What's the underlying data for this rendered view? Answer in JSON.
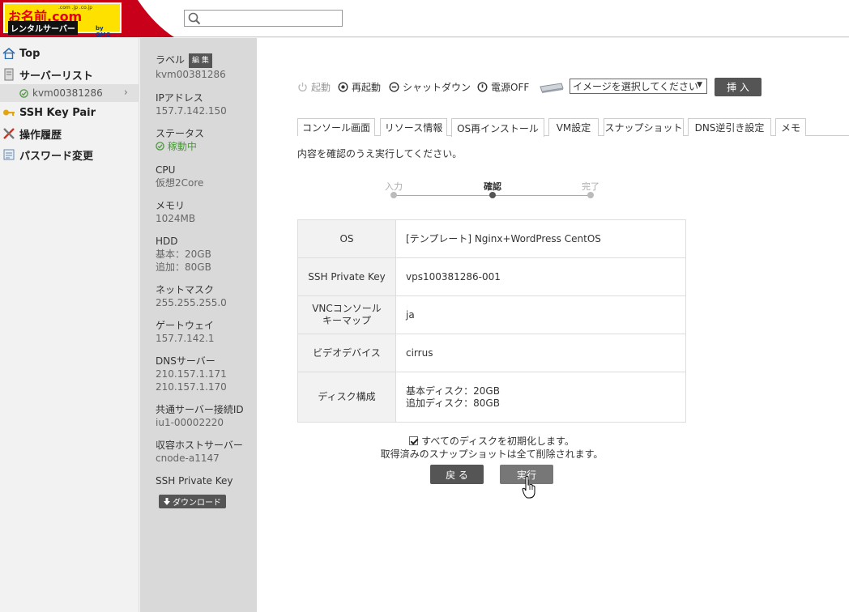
{
  "header": {
    "logo_main": "お名前.com",
    "logo_domains": ".com .jp .co.jp",
    "logo_sub": "レンタルサーバー",
    "logo_gmo": "by GMO",
    "search_placeholder": ""
  },
  "nav": {
    "top": "Top",
    "server_list": "サーバーリスト",
    "server_item": "kvm00381286",
    "ssh_key_pair": "SSH Key Pair",
    "history": "操作履歴",
    "password": "パスワード変更"
  },
  "info": {
    "label_title": "ラベル",
    "edit_badge": "編 集",
    "label_value": "kvm00381286",
    "ip_title": "IPアドレス",
    "ip_value": "157.7.142.150",
    "status_title": "ステータス",
    "status_value": "稼動中",
    "cpu_title": "CPU",
    "cpu_value": "仮想2Core",
    "memory_title": "メモリ",
    "memory_value": "1024MB",
    "hdd_title": "HDD",
    "hdd_base": "基本：20GB",
    "hdd_add": "追加：80GB",
    "netmask_title": "ネットマスク",
    "netmask_value": "255.255.255.0",
    "gateway_title": "ゲートウェイ",
    "gateway_value": "157.7.142.1",
    "dns_title": "DNSサーバー",
    "dns_value1": "210.157.1.171",
    "dns_value2": "210.157.1.170",
    "shared_title": "共通サーバー接続ID",
    "shared_value": "iu1-00002220",
    "host_title": "収容ホストサーバー",
    "host_value": "cnode-a1147",
    "ssh_title": "SSH Private Key",
    "download_label": "ダウンロード"
  },
  "toolbar": {
    "start": "起動",
    "restart": "再起動",
    "shutdown": "シャットダウン",
    "power_off": "電源OFF",
    "image_select": "イメージを選択してください",
    "insert": "挿 入"
  },
  "tabs": [
    "コンソール画面",
    "リソース情報",
    "OS再インストール",
    "VM設定",
    "スナップショット",
    "DNS逆引き設定",
    "メモ"
  ],
  "instruction": "内容を確認のうえ実行してください。",
  "steps": [
    "入力",
    "確認",
    "完了"
  ],
  "table": {
    "os_key": "OS",
    "os_value": "[テンプレート] Nginx+WordPress CentOS",
    "ssh_key": "SSH Private Key",
    "ssh_value": "vps100381286-001",
    "vnc_key1": "VNCコンソール",
    "vnc_key2": "キーマップ",
    "vnc_value": "ja",
    "video_key": "ビデオデバイス",
    "video_value": "cirrus",
    "disk_key": "ディスク構成",
    "disk_value1": "基本ディスク：20GB",
    "disk_value2": "追加ディスク：80GB"
  },
  "confirm": {
    "init_all": "すべてのディスクを初期化します。",
    "snapshot_warn": "取得済みのスナップショットは全て削除されます。",
    "back": "戻 る",
    "execute": "実行"
  },
  "colors": {
    "brand_red": "#e60012",
    "brand_yellow": "#ffe100",
    "status_green": "#4a9a3a",
    "button_dark": "#555555"
  }
}
